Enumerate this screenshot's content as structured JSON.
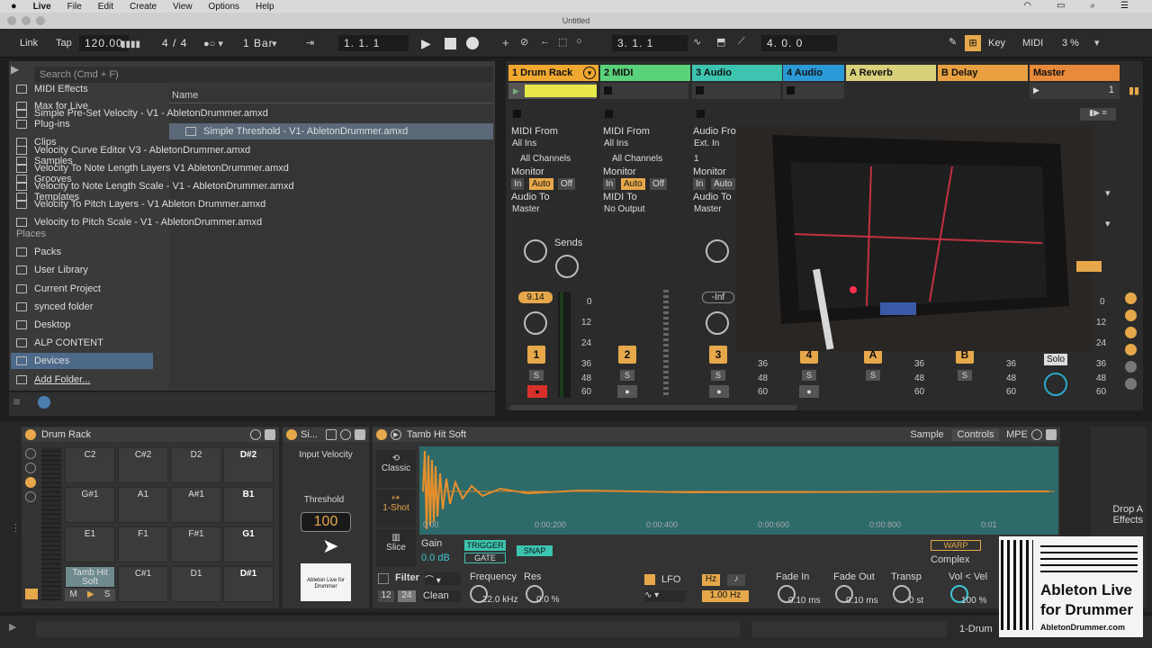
{
  "menubar": {
    "app": "Live",
    "items": [
      "File",
      "Edit",
      "Create",
      "View",
      "Options",
      "Help"
    ]
  },
  "window_title": "Untitled",
  "transport": {
    "link": "Link",
    "tap": "Tap",
    "tempo": "120.00",
    "signature": "4 / 4",
    "quantize": "1 Bar",
    "position": "1.   1.   1",
    "loop_start": "3.   1.   1",
    "loop_length": "4.   0.   0",
    "key": "Key",
    "midi": "MIDI",
    "cpu": "3 %"
  },
  "browser": {
    "search_placeholder": "Search (Cmd + F)",
    "categories": [
      "MIDI Effects",
      "Max for Live",
      "Plug-ins",
      "Clips",
      "Samples",
      "Grooves",
      "Templates"
    ],
    "places_header": "Places",
    "places": [
      "Packs",
      "User Library",
      "Current Project",
      "synced folder",
      "Desktop",
      "ALP CONTENT",
      "Devices",
      "Add Folder..."
    ],
    "name_header": "Name",
    "files": [
      "Simple Pre-Set Velocity  - V1 - AbletonDrummer.amxd",
      "Simple Threshold - V1- AbletonDrummer.amxd",
      "Velocity Curve Editor V3 - AbletonDrummer.amxd",
      "Velocity To Note Length Layers V1 AbletonDrummer.amxd",
      "Velocity to Note Length Scale - V1 - AbletonDrummer.amxd",
      "Velocity To Pitch Layers - V1 Ableton Drummer.amxd",
      "Velocity to Pitch Scale - V1 - AbletonDrummer.amxd"
    ]
  },
  "session": {
    "tracks": [
      {
        "name": "1 Drum Rack",
        "color": "#f0a830"
      },
      {
        "name": "2 MIDI",
        "color": "#5ad27a"
      },
      {
        "name": "3 Audio",
        "color": "#3cc4b0"
      },
      {
        "name": "4 Audio",
        "color": "#2a9ad6"
      },
      {
        "name": "A Reverb",
        "color": "#d8d07a"
      },
      {
        "name": "B Delay",
        "color": "#e8a040"
      },
      {
        "name": "Master",
        "color": "#e88a3a"
      }
    ],
    "io": {
      "midi_from": "MIDI From",
      "all_ins": "All Ins",
      "all_channels": "All Channels",
      "monitor": "Monitor",
      "in": "In",
      "auto": "Auto",
      "off": "Off",
      "audio_to": "Audio To",
      "master": "Master",
      "midi_to": "MIDI To",
      "no_output": "No Output",
      "audio_from": "Audio From",
      "ext_in": "Ext. In",
      "ch1": "1"
    },
    "sends": "Sends",
    "vol1": "9.14",
    "vol3": "-Inf",
    "nums": [
      "1",
      "2",
      "3",
      "4",
      "A",
      "B"
    ],
    "solo": "Solo",
    "s": "S",
    "db_scale": [
      "0",
      "12",
      "24",
      "36",
      "48",
      "60"
    ],
    "master_clip": "1"
  },
  "drum_rack": {
    "title": "Drum Rack",
    "pads": [
      "C2",
      "C#2",
      "D2",
      "D#2",
      "G#1",
      "A1",
      "A#1",
      "B1",
      "E1",
      "F1",
      "F#1",
      "G1",
      "Tamb Hit Soft",
      "C#1",
      "D1",
      "D#1"
    ],
    "m": "M",
    "s": "S"
  },
  "threshold_device": {
    "title": "Si...",
    "input_velocity": "Input Velocity",
    "threshold_label": "Threshold",
    "threshold_value": "100",
    "logo_text": "Ableton Live for Drummer"
  },
  "sampler": {
    "title": "Tamb Hit Soft",
    "tabs": [
      "Sample",
      "Controls",
      "MPE"
    ],
    "modes": [
      "Classic",
      "1-Shot",
      "Slice"
    ],
    "timeline": [
      "0:00",
      "0:00:200",
      "0:00:400",
      "0:00:600",
      "0:00:800",
      "0:01"
    ],
    "gain_label": "Gain",
    "gain_value": "0.0 dB",
    "trigger": "TRIGGER",
    "gate": "GATE",
    "snap": "SNAP",
    "warp": "WARP",
    "complex": "Complex",
    "filter": "Filter",
    "frequency_label": "Frequency",
    "frequency_value": "22.0 kHz",
    "res_label": "Res",
    "res_value": "0.0 %",
    "clean": "Clean",
    "f12": "12",
    "f24": "24",
    "lfo": "LFO",
    "hz": "Hz",
    "lfo_rate": "1.00 Hz",
    "fade_in_label": "Fade In",
    "fade_in_value": "0.10 ms",
    "fade_out_label": "Fade Out",
    "fade_out_value": "0.10 ms",
    "transp_label": "Transp",
    "transp_value": "0 st",
    "vol_vel_label": "Vol < Vel",
    "vol_vel_value": "100 %"
  },
  "drop_effects": "Drop A Effects",
  "status": {
    "track": "1-Drum"
  },
  "overlay_logo": {
    "line1": "Ableton Live",
    "line2": "for Drummer",
    "url": "AbletonDrummer.com"
  }
}
